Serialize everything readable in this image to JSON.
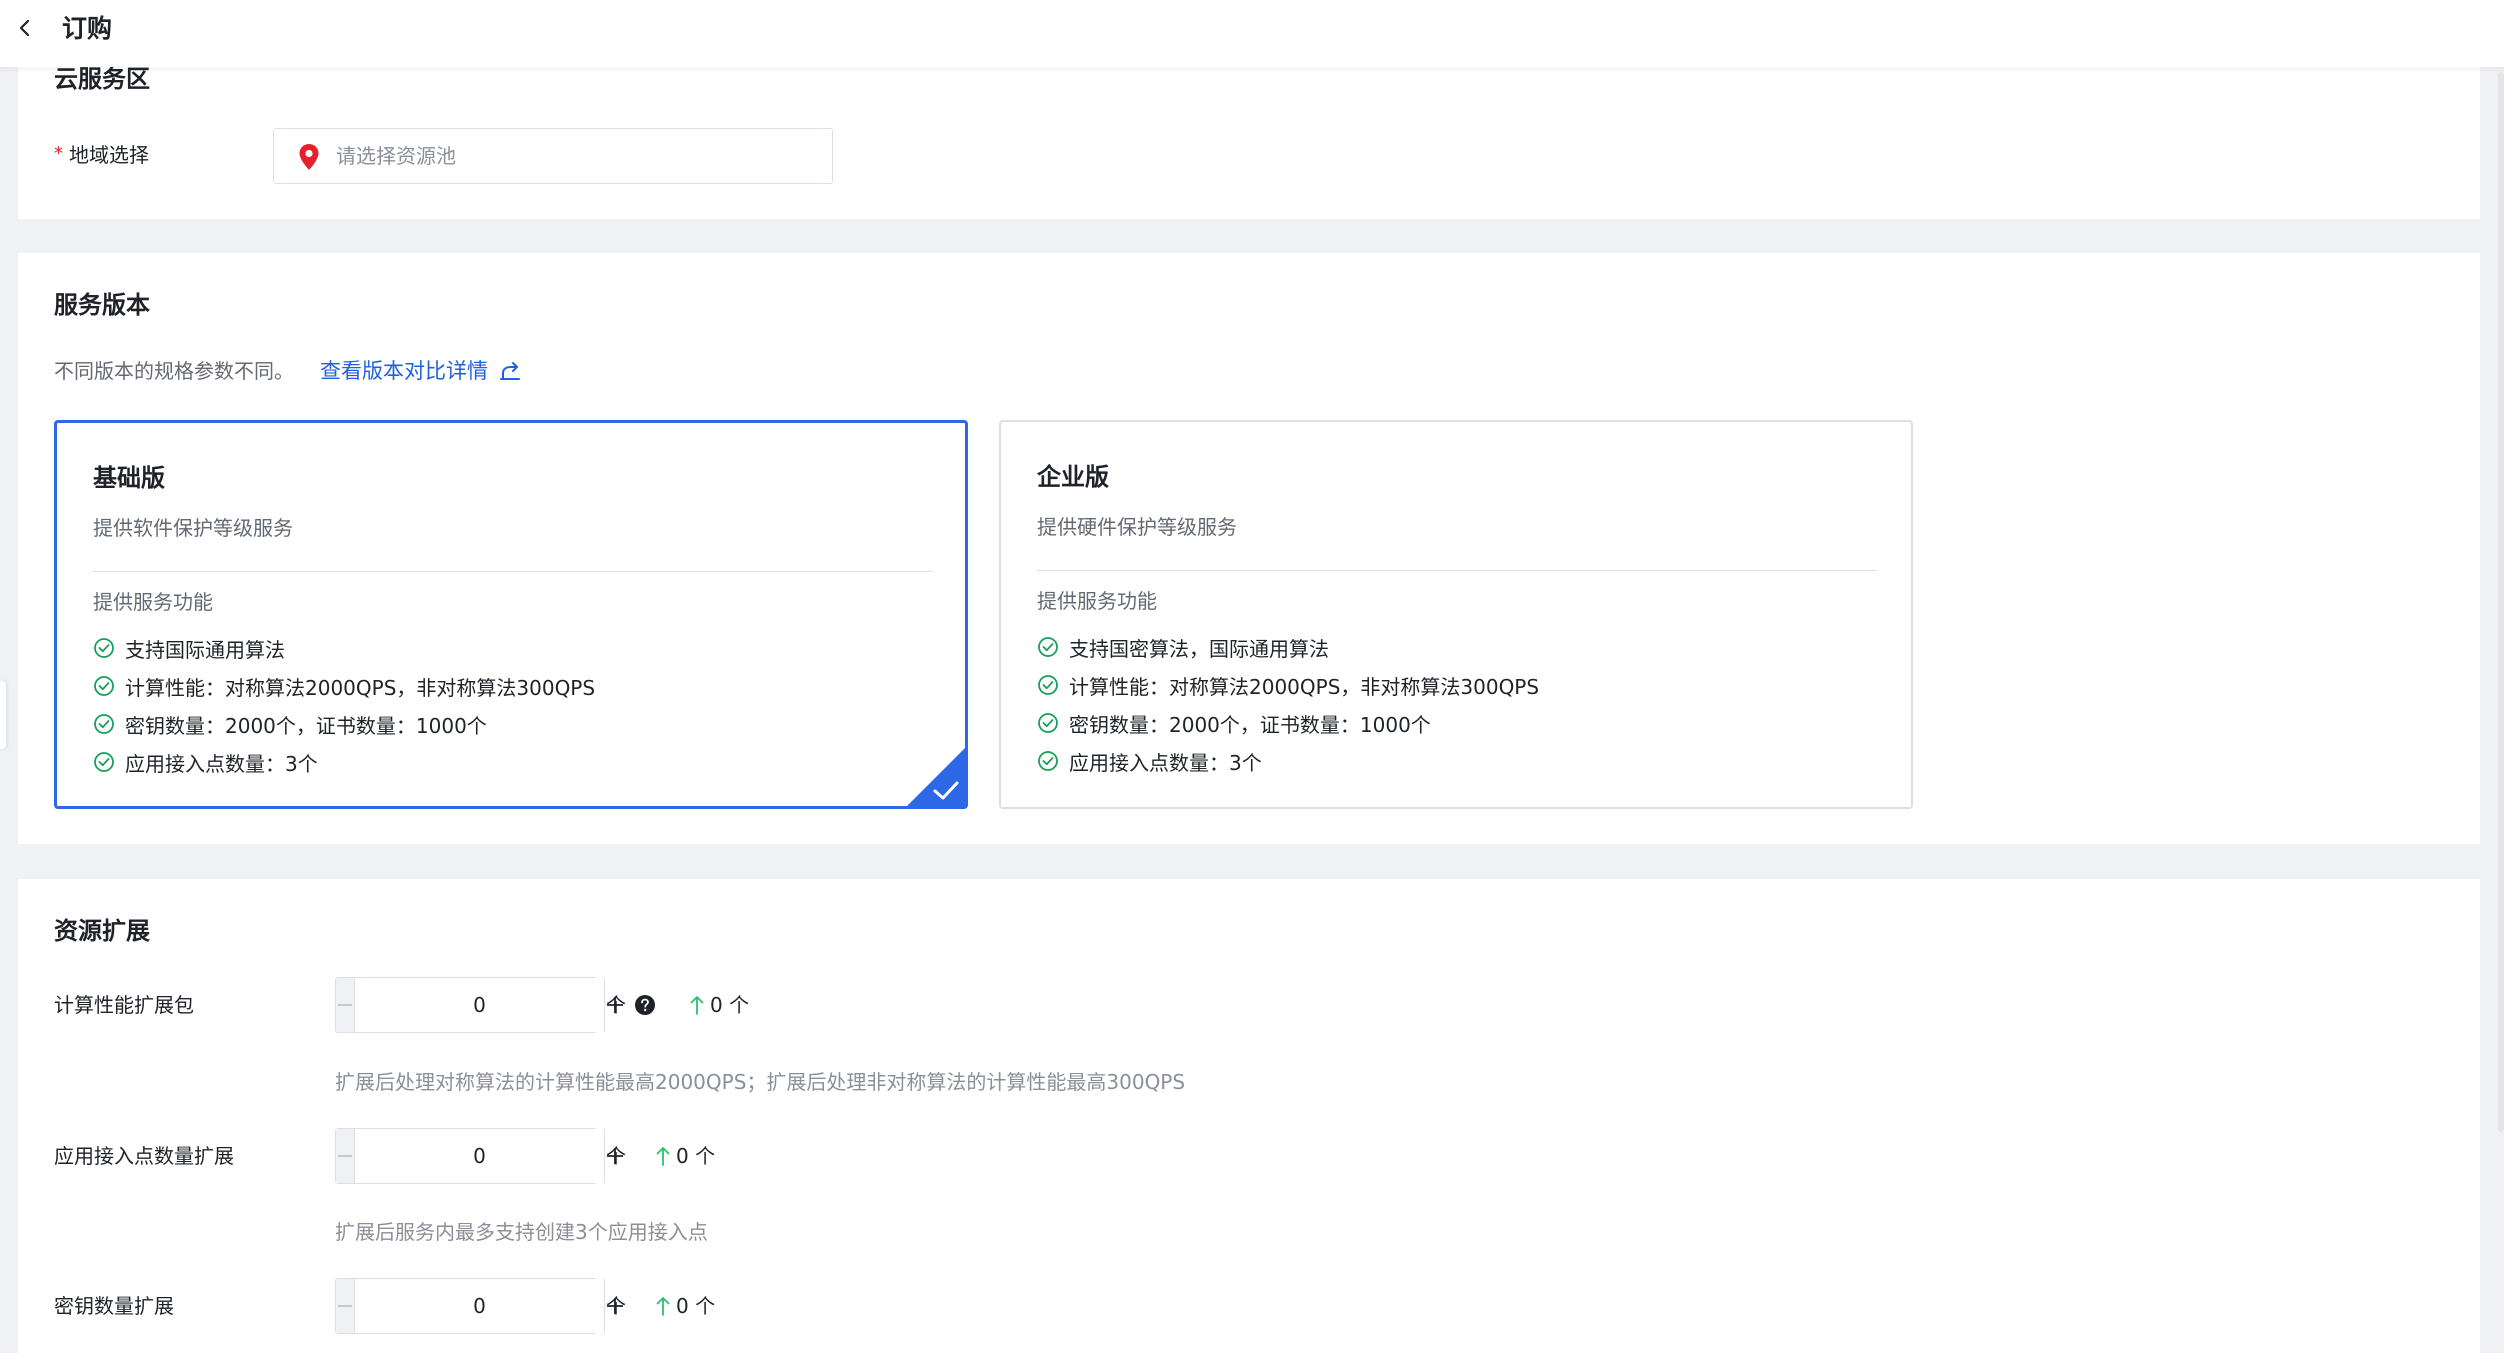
{
  "header": {
    "title": "订购"
  },
  "region_section": {
    "title": "云服务区",
    "required_mark": "*",
    "label": "地域选择",
    "placeholder": "请选择资源池"
  },
  "version_section": {
    "title": "服务版本",
    "description": "不同版本的规格参数不同。",
    "compare_link": "查看版本对比详情",
    "plans": [
      {
        "name": "基础版",
        "subtitle": "提供软件保护等级服务",
        "features_title": "提供服务功能",
        "features": [
          "支持国际通用算法",
          "计算性能：对称算法2000QPS，非对称算法300QPS",
          "密钥数量：2000个，证书数量：1000个",
          "应用接入点数量：3个"
        ],
        "selected": true
      },
      {
        "name": "企业版",
        "subtitle": "提供硬件保护等级服务",
        "features_title": "提供服务功能",
        "features": [
          "支持国密算法，国际通用算法",
          "计算性能：对称算法2000QPS，非对称算法300QPS",
          "密钥数量：2000个，证书数量：1000个",
          "应用接入点数量：3个"
        ],
        "selected": false
      }
    ]
  },
  "resource_section": {
    "title": "资源扩展",
    "items": [
      {
        "label": "计算性能扩展包",
        "value": "0",
        "unit": "个",
        "increase": "0 个",
        "hint": "扩展后处理对称算法的计算性能最高2000QPS；扩展后处理非对称算法的计算性能最高300QPS"
      },
      {
        "label": "应用接入点数量扩展",
        "value": "0",
        "unit": "个",
        "increase": "0 个",
        "hint": "扩展后服务内最多支持创建3个应用接入点"
      },
      {
        "label": "密钥数量扩展",
        "value": "0",
        "unit": "个",
        "increase": "0 个"
      }
    ]
  },
  "colors": {
    "primary": "#2e68e6",
    "link": "#1f62e0",
    "success": "#18a058",
    "required": "#e5202e",
    "increase": "#2fbf71"
  },
  "icons": [
    "chevron-left-icon",
    "map-pin-icon",
    "share-link-icon",
    "check-circle-icon",
    "corner-check-icon",
    "minus-icon",
    "plus-icon",
    "help-icon",
    "arrow-up-icon"
  ]
}
